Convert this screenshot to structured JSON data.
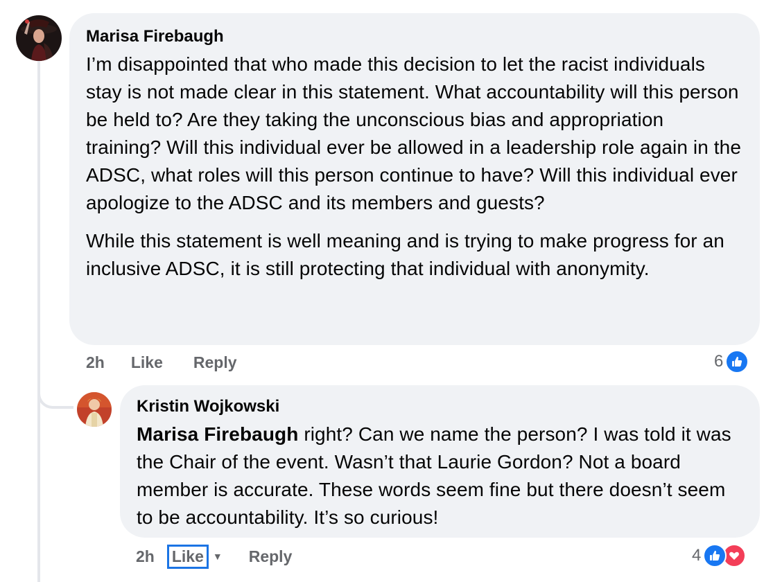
{
  "comments": [
    {
      "author": "Marisa Firebaugh",
      "paragraphs": [
        "I’m disappointed that who made this decision to let the racist individuals stay is not made clear in this statement. What accountability will this person be held to? Are they taking the unconscious bias and appropriation training? Will this individual ever be allowed in a leadership role again in the ADSC, what roles will this person continue to have? Will this individual ever apologize to the ADSC and its members and guests?",
        "While this statement is well meaning and is trying to make progress for an inclusive ADSC, it is still protecting that individual with anonymity."
      ],
      "time": "2h",
      "like_label": "Like",
      "reply_label": "Reply",
      "reaction_count": "6",
      "reactions": [
        "like-icon"
      ]
    },
    {
      "author": "Kristin Wojkowski",
      "mention": "Marisa Firebaugh",
      "text": " right? Can we name the person? I was told it was the Chair of the event. Wasn’t that Laurie Gordon? Not a board member is accurate. These words seem fine but there doesn’t seem to be accountability. It’s so curious!",
      "time": "2h",
      "like_label": "Like",
      "reply_label": "Reply",
      "reaction_count": "4",
      "reactions": [
        "like-icon",
        "love-icon"
      ]
    }
  ],
  "colors": {
    "bubble": "#f0f2f5",
    "meta_text": "#65676b",
    "like_blue": "#1877f2",
    "love_red": "#f33e58",
    "focus_outline": "#1b74e4"
  }
}
